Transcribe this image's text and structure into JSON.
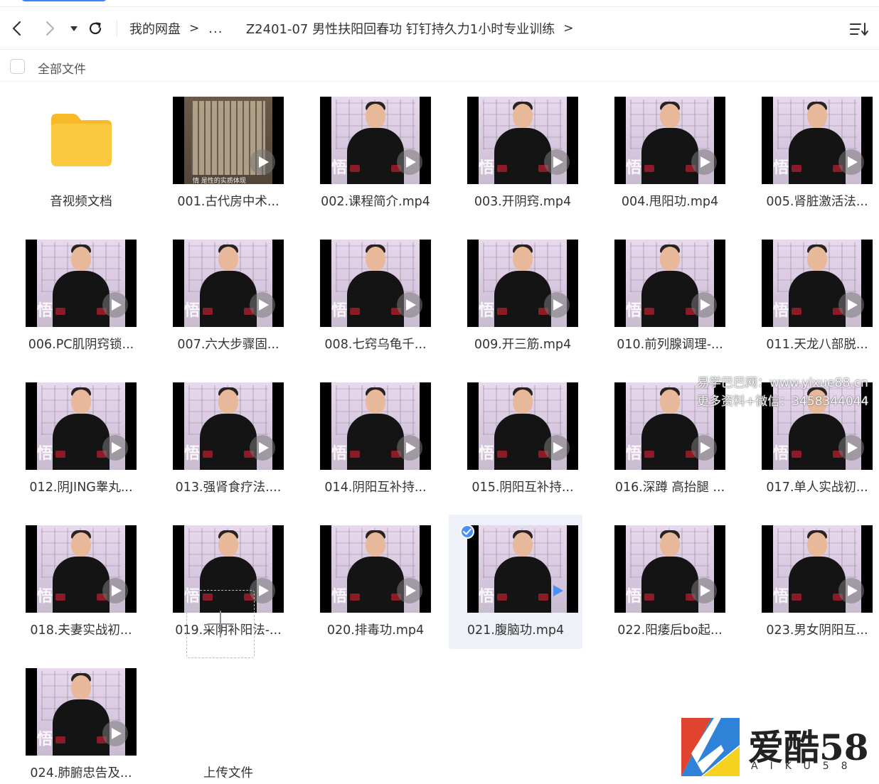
{
  "toolbar": {
    "breadcrumb": {
      "root": "我的网盘",
      "ellipsis": "...",
      "current": "Z2401-07 男性扶阳回春功 钉钉持久力1小时专业训练"
    }
  },
  "select_bar": {
    "label": "全部文件"
  },
  "files": [
    {
      "name": "音视频文档",
      "type": "folder"
    },
    {
      "name": "001.古代房中术...",
      "type": "video",
      "thumb": "book",
      "caption": "情 是性的实质体现"
    },
    {
      "name": "002.课程简介.mp4",
      "type": "video"
    },
    {
      "name": "003.开阴窍.mp4",
      "type": "video"
    },
    {
      "name": "004.甩阳功.mp4",
      "type": "video"
    },
    {
      "name": "005.肾脏激活法...",
      "type": "video"
    },
    {
      "name": "006.PC肌阴窍锁...",
      "type": "video"
    },
    {
      "name": "007.六大步骤固...",
      "type": "video"
    },
    {
      "name": "008.七窍乌龟千...",
      "type": "video"
    },
    {
      "name": "009.开三筋.mp4",
      "type": "video"
    },
    {
      "name": "010.前列腺调理-...",
      "type": "video"
    },
    {
      "name": "011.天龙八部脱...",
      "type": "video"
    },
    {
      "name": "012.阴JING睾丸...",
      "type": "video"
    },
    {
      "name": "013.强肾食疗法....",
      "type": "video"
    },
    {
      "name": "014.阴阳互补持...",
      "type": "video"
    },
    {
      "name": "015.阴阳互补持...",
      "type": "video"
    },
    {
      "name": "016.深蹲 高抬腿 ...",
      "type": "video"
    },
    {
      "name": "017.单人实战初...",
      "type": "video"
    },
    {
      "name": "018.夫妻实战初...",
      "type": "video"
    },
    {
      "name": "019.采阴补阳法-...",
      "type": "video"
    },
    {
      "name": "020.排毒功.mp4",
      "type": "video"
    },
    {
      "name": "021.腹脑功.mp4",
      "type": "video",
      "selected": true
    },
    {
      "name": "022.阳痿后bo起...",
      "type": "video"
    },
    {
      "name": "023.男女阴阳互...",
      "type": "video"
    },
    {
      "name": "024.肺腑忠告及...",
      "type": "video"
    }
  ],
  "upload": {
    "label": "上传文件"
  },
  "watermark": {
    "line1": "易学巴巴网：www.yixue88.cn",
    "line2": "更多资料+微信：3458344044"
  },
  "logo": {
    "cn": "爱酷58",
    "en": "AIKU58"
  },
  "colors": {
    "accent": "#3b82f6",
    "folder": "#fbc93f",
    "selected_bg": "#eef1f7",
    "badge": "#4b8ff7"
  },
  "icons": {
    "back": "chevron-left-icon",
    "forward": "chevron-right-icon",
    "dropdown": "caret-down-icon",
    "refresh": "refresh-icon",
    "sort": "sort-icon",
    "play": "play-icon",
    "check": "check-icon",
    "plus": "plus-icon",
    "folder": "folder-icon"
  }
}
